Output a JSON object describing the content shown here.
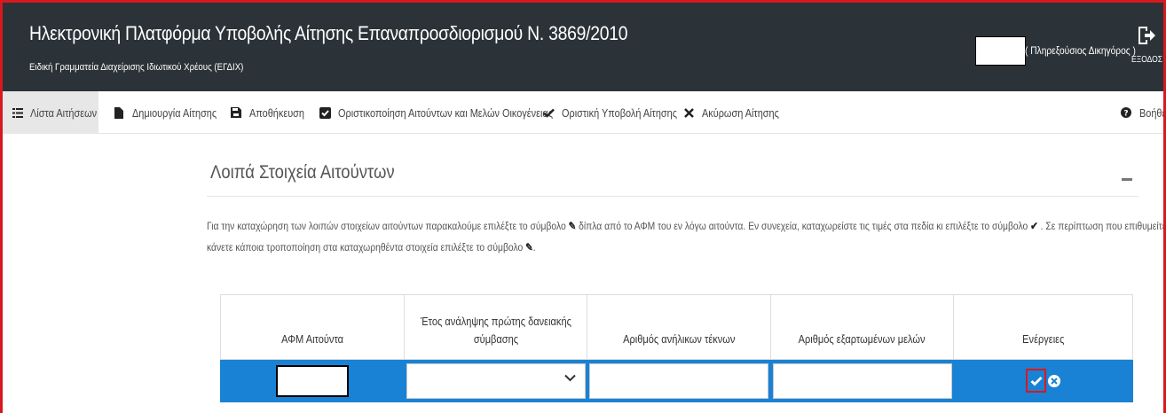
{
  "header": {
    "title": "Ηλεκτρονική Πλατφόρμα Υποβολής Αίτησης Επαναπροσδιορισμού Ν. 3869/2010",
    "subtitle": "Ειδική Γραμματεία Διαχείρισης Ιδιωτικού Χρέους (ΕΓΔΙΧ)",
    "user_role": "( Πληρεξούσιος Δικηγόρος )",
    "exit_label": "ΕΞΟΔΟΣ",
    "exit_icon": "sign-out-icon"
  },
  "menu": {
    "items": [
      {
        "label": "Λίστα Αιτήσεων",
        "icon": "list-icon"
      },
      {
        "label": "Δημιουργία Αίτησης",
        "icon": "file-icon"
      },
      {
        "label": "Αποθήκευση",
        "icon": "save-icon"
      },
      {
        "label": "Οριστικοποίηση Αιτούντων και Μελών Οικογένειας",
        "icon": "checkbox-icon"
      },
      {
        "label": "Οριστική Υποβολή Αίτησης",
        "icon": "check-icon"
      },
      {
        "label": "Ακύρωση Αίτησης",
        "icon": "times-icon"
      },
      {
        "label": "Βοήθεια",
        "icon": "question-circle-icon"
      }
    ]
  },
  "section": {
    "title": "Λοιπά Στοιχεία Αιτούντων",
    "instructions_line1_a": "Για την καταχώρηση των λοιπών στοιχείων αιτούντων παρακαλούμε επιλέξτε το σύμβολο",
    "instructions_line1_b": "δίπλα από το ΑΦΜ του εν λόγω αιτούντα. Εν συνεχεία, καταχωρείστε τις τιμές στα πεδία κι επιλέξτε το σύμβολο",
    "instructions_line1_c": ". Σε περίπτωση που επιθυμείτε να",
    "instructions_line2": "κάνετε κάποια τροποποίηση στα καταχωρηθέντα στοιχεία επιλέξτε το σύμβολο",
    "instructions_line2_end": "."
  },
  "table": {
    "headers": {
      "afm": "ΑΦΜ Αιτούντα",
      "year_line1": "Έτος ανάληψης πρώτης δανειακής",
      "year_line2": "σύμβασης",
      "minors": "Αριθμός ανήλικων τέκνων",
      "dependents": "Αριθμός εξαρτωμένων μελών",
      "actions": "Ενέργειες"
    },
    "row": {
      "afm_value": "",
      "year_value": "",
      "minors_value": "",
      "dependents_value": ""
    }
  },
  "colors": {
    "header_bg": "#2b3338",
    "row_highlight": "#1a82d4",
    "annotation_red": "#d7191f"
  }
}
